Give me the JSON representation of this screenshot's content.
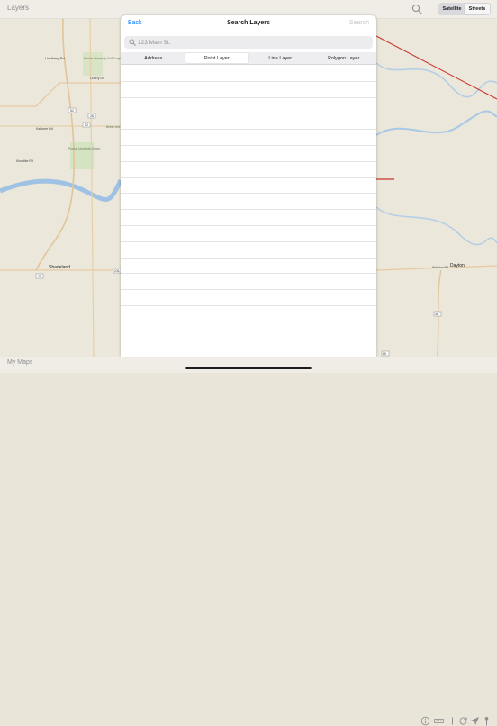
{
  "topbar": {
    "title": "Layers",
    "search_icon": "search-icon",
    "map_modes": [
      {
        "label": "Satellite",
        "active": false
      },
      {
        "label": "Streets",
        "active": true
      }
    ]
  },
  "map": {
    "labels": [
      "Lindberg Rd",
      "Purdue University Golf Complex",
      "Cherry Ln",
      "Kalberer Rd",
      "Purdue University Airport",
      "Beeler Ave",
      "Klondike Rd",
      "Shadeland",
      "Dayton",
      "Walston Rd"
    ],
    "route_numbers": [
      "52",
      "26",
      "52",
      "231",
      "25",
      "38",
      "65",
      "38",
      "25"
    ]
  },
  "modal": {
    "back_label": "Back",
    "title": "Search Layers",
    "search_label": "Search",
    "search_placeholder": "123 Main St.",
    "search_value": "",
    "tabs": [
      {
        "label": "Address",
        "active": false
      },
      {
        "label": "Point Layer",
        "active": true
      },
      {
        "label": "Line Layer",
        "active": false
      },
      {
        "label": "Polygon Layer",
        "active": false
      }
    ],
    "empty_row_count": 15
  },
  "bottombar": {
    "label": "My Maps",
    "tools": [
      "info-icon",
      "ruler-icon",
      "plus-icon",
      "refresh-icon",
      "location-arrow-icon",
      "pin-icon"
    ]
  },
  "colors": {
    "accent": "#007aff",
    "map_water": "#9fc2e4",
    "map_route": "#c7342e"
  }
}
